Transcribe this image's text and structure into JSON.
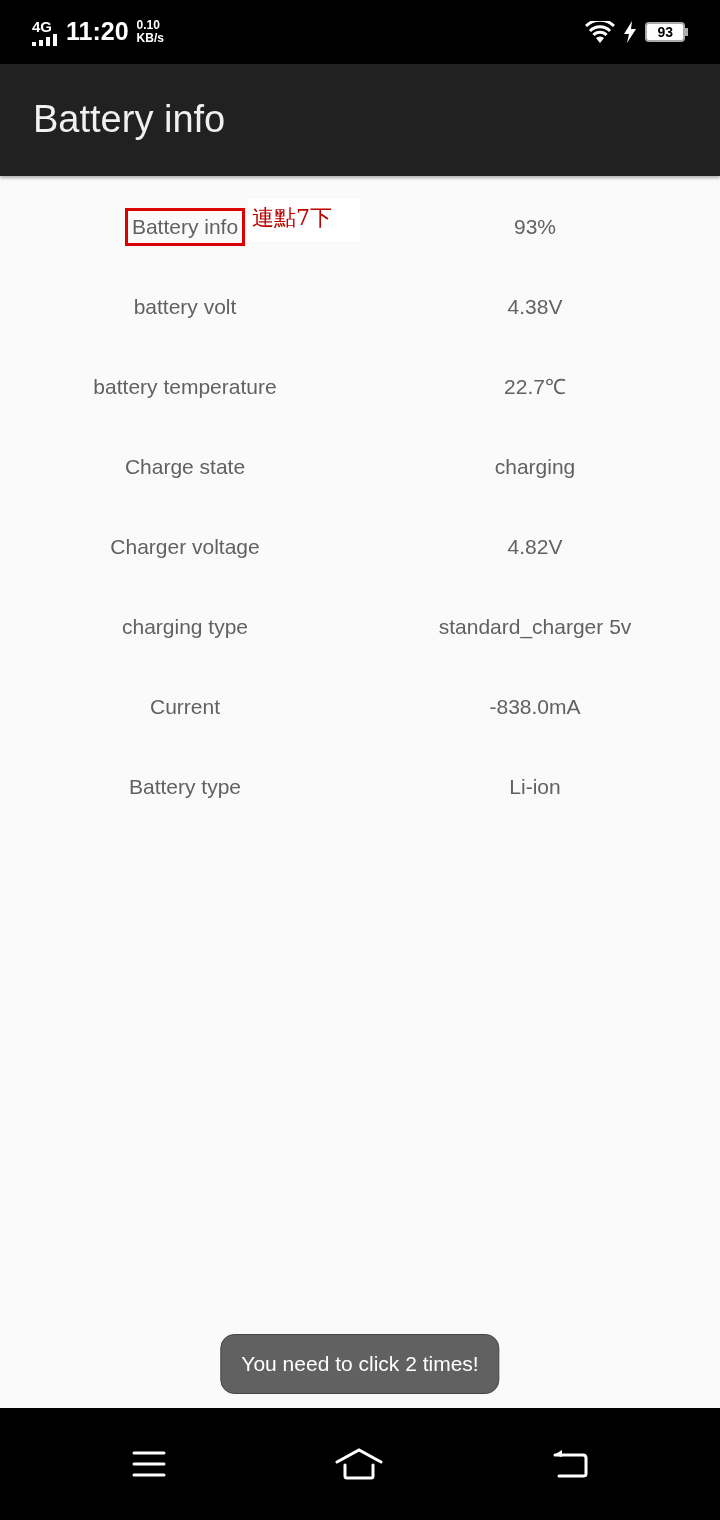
{
  "status_bar": {
    "network": "4G",
    "time": "11:20",
    "speed_value": "0.10",
    "speed_unit": "KB/s",
    "charging": true,
    "battery": "93"
  },
  "app_bar": {
    "title": "Battery info"
  },
  "rows": [
    {
      "label": "Battery info",
      "value": "93%",
      "highlighted": true
    },
    {
      "label": "battery volt",
      "value": "4.38V",
      "highlighted": false
    },
    {
      "label": "battery temperature",
      "value": "22.7℃",
      "highlighted": false
    },
    {
      "label": "Charge state",
      "value": "charging",
      "highlighted": false
    },
    {
      "label": "Charger voltage",
      "value": "4.82V",
      "highlighted": false
    },
    {
      "label": "charging type",
      "value": "standard_charger 5v",
      "highlighted": false
    },
    {
      "label": "Current",
      "value": "-838.0mA",
      "highlighted": false
    },
    {
      "label": "Battery type",
      "value": "Li-ion",
      "highlighted": false
    }
  ],
  "annotation": {
    "text": "連點7下"
  },
  "toast": {
    "text": "You need to click 2 times!"
  }
}
